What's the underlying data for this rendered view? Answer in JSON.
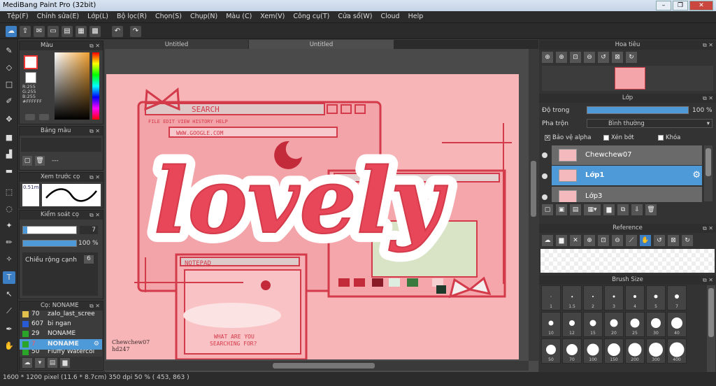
{
  "window": {
    "title": "MediBang Paint Pro (32bit)"
  },
  "menu": [
    "Tệp(F)",
    "Chỉnh sửa(E)",
    "Lớp(L)",
    "Bộ lọc(R)",
    "Chọn(S)",
    "Chụp(N)",
    "Màu (C)",
    "Xem(V)",
    "Công cụ(T)",
    "Cửa sổ(W)",
    "Cloud",
    "Help"
  ],
  "tabs": [
    "Untitled",
    "Untitled"
  ],
  "color_panel": {
    "title": "Màu",
    "r": "R:255",
    "g": "G:255",
    "b": "B:255",
    "hex": "#FFFFFF"
  },
  "palette_panel": {
    "title": "Bảng màu",
    "dash": "---"
  },
  "brush_preview": {
    "title": "Xem trước cọ",
    "size": "0.51mm"
  },
  "brush_control": {
    "title": "Kiểm soát cọ",
    "size": "7",
    "opacity": "100 %",
    "width_label": "Chiều rộng cạnh",
    "width_val": "6"
  },
  "brush_list": {
    "title": "Cọ: NONAME",
    "items": [
      {
        "num": "70",
        "name": "zalo_last_scree",
        "color": "#e1c04b"
      },
      {
        "num": "607",
        "name": "bi ngan",
        "color": "#2a5bd7"
      },
      {
        "num": "29",
        "name": "NONAME",
        "color": "#2aa52a"
      },
      {
        "num": "7",
        "name": "NONAME",
        "color": "#2aa52a"
      },
      {
        "num": "50",
        "name": "Fluffy Watercol",
        "color": "#2aa52a"
      }
    ]
  },
  "navigator": {
    "title": "Hoa tiêu"
  },
  "layer_panel": {
    "title": "Lớp",
    "opacity_label": "Độ trong",
    "opacity_val": "100 %",
    "blend_label": "Pha trộn",
    "blend_val": "Bình thường",
    "protect_alpha": "Bảo vệ alpha",
    "clipping": "Xén bớt",
    "lock": "Khóa",
    "layers": [
      "Chewchew07",
      "Lớp1",
      "Lớp3"
    ]
  },
  "reference": {
    "title": "Reference"
  },
  "brush_size": {
    "title": "Brush Size",
    "sizes": [
      "1",
      "1.5",
      "2",
      "3",
      "4",
      "5",
      "7",
      "10",
      "12",
      "15",
      "20",
      "25",
      "30",
      "40",
      "50",
      "70",
      "100",
      "150",
      "200",
      "300",
      "400"
    ]
  },
  "artwork": {
    "search_text": "SEARCH",
    "menu_text": "FILE  EDIT  VIEW  HISTORY  HELP",
    "url": "WWW.GOOGLE.COM",
    "notepad": "NOTEPAD",
    "bottom_text1": "WHAT ARE YOU",
    "bottom_text2": "SEARCHING FOR?",
    "big_word": "lovely",
    "signature1": "Chewchew07",
    "signature2": "hd247",
    "jpg": "JPG"
  },
  "status": {
    "text": "1600 * 1200 pixel  (11.6 * 8.7cm)  350 dpi  50 %  ( 453, 863 )"
  },
  "colors": {
    "accent": "#3d7fc4",
    "pink": "#f7b5b8",
    "red": "#e8475a"
  }
}
